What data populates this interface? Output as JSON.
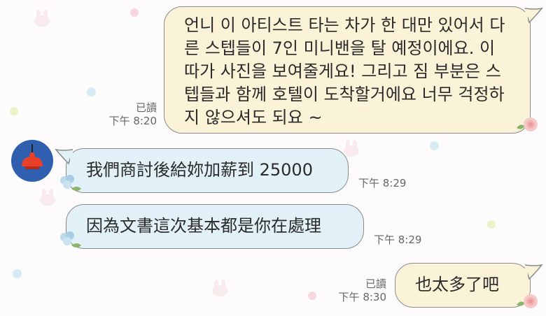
{
  "colors": {
    "outgoing_bubble": "#fbf3d7",
    "incoming_bubble": "#e2f1f7",
    "bubble_border": "#8a8a8a",
    "avatar_bg": "#2f5fae",
    "avatar_lamp": "#e8402a"
  },
  "messages": [
    {
      "direction": "outgoing",
      "lines": [
        "언니 이 아티스트 타는 차가 한 대만 있어서 다",
        "른 스텝들이 7인 미니밴을 탈 예정이에요. 이",
        "따가 사진을 보여줄게요! 그리고 짐 부분은 스",
        "텝들과 함께 호텔이 도착할거에요 너무 걱정하",
        "지 않으셔도 되요 ~"
      ],
      "read": "已讀",
      "time": "下午 8:20"
    },
    {
      "direction": "incoming",
      "text": "我們商討後給妳加薪到 25000",
      "time": "下午 8:29"
    },
    {
      "direction": "incoming",
      "text": "因為文書這次基本都是你在處理",
      "time": "下午 8:29"
    },
    {
      "direction": "outgoing",
      "text": "也太多了吧",
      "read": "已讀",
      "time": "下午 8:30"
    }
  ],
  "avatar_icon": "pendant-lamp-icon"
}
